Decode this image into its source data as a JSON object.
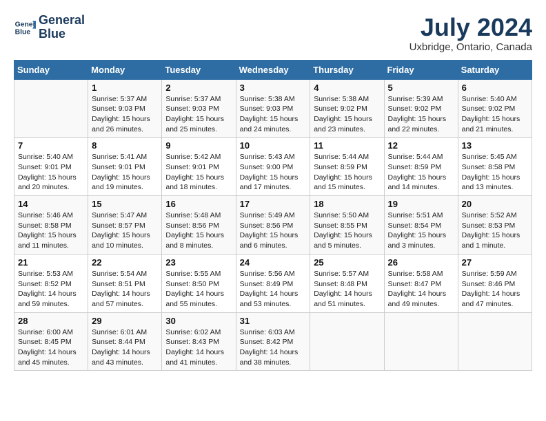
{
  "logo": {
    "line1": "General",
    "line2": "Blue"
  },
  "title": "July 2024",
  "subtitle": "Uxbridge, Ontario, Canada",
  "headers": [
    "Sunday",
    "Monday",
    "Tuesday",
    "Wednesday",
    "Thursday",
    "Friday",
    "Saturday"
  ],
  "weeks": [
    [
      {
        "day": "",
        "info": ""
      },
      {
        "day": "1",
        "info": "Sunrise: 5:37 AM\nSunset: 9:03 PM\nDaylight: 15 hours\nand 26 minutes."
      },
      {
        "day": "2",
        "info": "Sunrise: 5:37 AM\nSunset: 9:03 PM\nDaylight: 15 hours\nand 25 minutes."
      },
      {
        "day": "3",
        "info": "Sunrise: 5:38 AM\nSunset: 9:03 PM\nDaylight: 15 hours\nand 24 minutes."
      },
      {
        "day": "4",
        "info": "Sunrise: 5:38 AM\nSunset: 9:02 PM\nDaylight: 15 hours\nand 23 minutes."
      },
      {
        "day": "5",
        "info": "Sunrise: 5:39 AM\nSunset: 9:02 PM\nDaylight: 15 hours\nand 22 minutes."
      },
      {
        "day": "6",
        "info": "Sunrise: 5:40 AM\nSunset: 9:02 PM\nDaylight: 15 hours\nand 21 minutes."
      }
    ],
    [
      {
        "day": "7",
        "info": "Sunrise: 5:40 AM\nSunset: 9:01 PM\nDaylight: 15 hours\nand 20 minutes."
      },
      {
        "day": "8",
        "info": "Sunrise: 5:41 AM\nSunset: 9:01 PM\nDaylight: 15 hours\nand 19 minutes."
      },
      {
        "day": "9",
        "info": "Sunrise: 5:42 AM\nSunset: 9:01 PM\nDaylight: 15 hours\nand 18 minutes."
      },
      {
        "day": "10",
        "info": "Sunrise: 5:43 AM\nSunset: 9:00 PM\nDaylight: 15 hours\nand 17 minutes."
      },
      {
        "day": "11",
        "info": "Sunrise: 5:44 AM\nSunset: 8:59 PM\nDaylight: 15 hours\nand 15 minutes."
      },
      {
        "day": "12",
        "info": "Sunrise: 5:44 AM\nSunset: 8:59 PM\nDaylight: 15 hours\nand 14 minutes."
      },
      {
        "day": "13",
        "info": "Sunrise: 5:45 AM\nSunset: 8:58 PM\nDaylight: 15 hours\nand 13 minutes."
      }
    ],
    [
      {
        "day": "14",
        "info": "Sunrise: 5:46 AM\nSunset: 8:58 PM\nDaylight: 15 hours\nand 11 minutes."
      },
      {
        "day": "15",
        "info": "Sunrise: 5:47 AM\nSunset: 8:57 PM\nDaylight: 15 hours\nand 10 minutes."
      },
      {
        "day": "16",
        "info": "Sunrise: 5:48 AM\nSunset: 8:56 PM\nDaylight: 15 hours\nand 8 minutes."
      },
      {
        "day": "17",
        "info": "Sunrise: 5:49 AM\nSunset: 8:56 PM\nDaylight: 15 hours\nand 6 minutes."
      },
      {
        "day": "18",
        "info": "Sunrise: 5:50 AM\nSunset: 8:55 PM\nDaylight: 15 hours\nand 5 minutes."
      },
      {
        "day": "19",
        "info": "Sunrise: 5:51 AM\nSunset: 8:54 PM\nDaylight: 15 hours\nand 3 minutes."
      },
      {
        "day": "20",
        "info": "Sunrise: 5:52 AM\nSunset: 8:53 PM\nDaylight: 15 hours\nand 1 minute."
      }
    ],
    [
      {
        "day": "21",
        "info": "Sunrise: 5:53 AM\nSunset: 8:52 PM\nDaylight: 14 hours\nand 59 minutes."
      },
      {
        "day": "22",
        "info": "Sunrise: 5:54 AM\nSunset: 8:51 PM\nDaylight: 14 hours\nand 57 minutes."
      },
      {
        "day": "23",
        "info": "Sunrise: 5:55 AM\nSunset: 8:50 PM\nDaylight: 14 hours\nand 55 minutes."
      },
      {
        "day": "24",
        "info": "Sunrise: 5:56 AM\nSunset: 8:49 PM\nDaylight: 14 hours\nand 53 minutes."
      },
      {
        "day": "25",
        "info": "Sunrise: 5:57 AM\nSunset: 8:48 PM\nDaylight: 14 hours\nand 51 minutes."
      },
      {
        "day": "26",
        "info": "Sunrise: 5:58 AM\nSunset: 8:47 PM\nDaylight: 14 hours\nand 49 minutes."
      },
      {
        "day": "27",
        "info": "Sunrise: 5:59 AM\nSunset: 8:46 PM\nDaylight: 14 hours\nand 47 minutes."
      }
    ],
    [
      {
        "day": "28",
        "info": "Sunrise: 6:00 AM\nSunset: 8:45 PM\nDaylight: 14 hours\nand 45 minutes."
      },
      {
        "day": "29",
        "info": "Sunrise: 6:01 AM\nSunset: 8:44 PM\nDaylight: 14 hours\nand 43 minutes."
      },
      {
        "day": "30",
        "info": "Sunrise: 6:02 AM\nSunset: 8:43 PM\nDaylight: 14 hours\nand 41 minutes."
      },
      {
        "day": "31",
        "info": "Sunrise: 6:03 AM\nSunset: 8:42 PM\nDaylight: 14 hours\nand 38 minutes."
      },
      {
        "day": "",
        "info": ""
      },
      {
        "day": "",
        "info": ""
      },
      {
        "day": "",
        "info": ""
      }
    ]
  ]
}
